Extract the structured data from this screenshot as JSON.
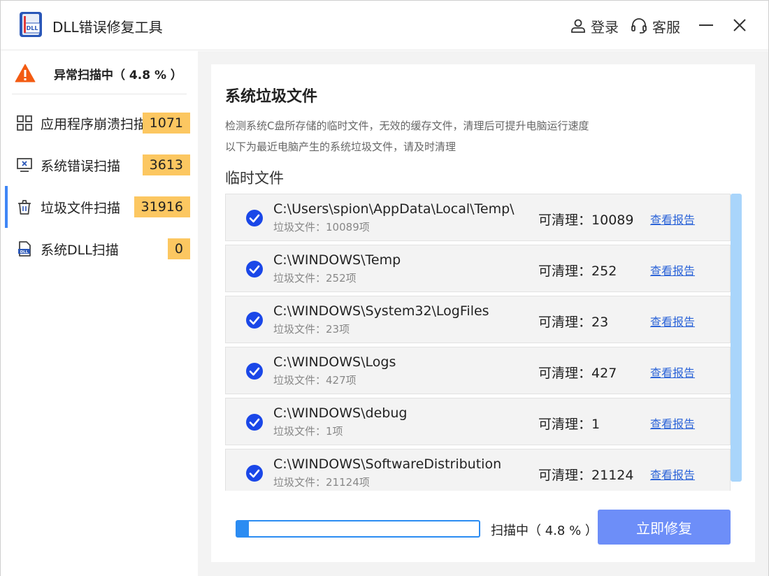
{
  "app": {
    "title": "DLL错误修复工具",
    "logo_text": "DLL"
  },
  "titlebar": {
    "login_label": "登录",
    "service_label": "客服"
  },
  "sidebar": {
    "status_label": "异常扫描中（ 4.8 % ）",
    "items": [
      {
        "label": "应用程序崩溃扫描",
        "count": "1071",
        "icon": "grid-icon"
      },
      {
        "label": "系统错误扫描",
        "count": "3613",
        "icon": "monitor-error-icon"
      },
      {
        "label": "垃圾文件扫描",
        "count": "31916",
        "icon": "trash-icon",
        "active": true
      },
      {
        "label": "系统DLL扫描",
        "count": "0",
        "icon": "dll-file-icon"
      }
    ]
  },
  "main": {
    "title": "系统垃圾文件",
    "desc1": "检测系统C盘所存储的临时文件，无效的缓存文件，清理后可提升电脑运行速度",
    "desc2": "以下为最近电脑产生的系统垃圾文件，请及时清理",
    "section_title": "临时文件",
    "rows": [
      {
        "path": "C:\\Users\\spion\\AppData\\Local\\Temp\\",
        "sub_prefix": "垃圾文件：",
        "sub_count": "10089项",
        "clean_prefix": "可清理：",
        "clean_count": "10089",
        "report": "查看报告"
      },
      {
        "path": "C:\\WINDOWS\\Temp",
        "sub_prefix": "垃圾文件：",
        "sub_count": "252项",
        "clean_prefix": "可清理：",
        "clean_count": "252",
        "report": "查看报告"
      },
      {
        "path": "C:\\WINDOWS\\System32\\LogFiles",
        "sub_prefix": "垃圾文件：",
        "sub_count": "23项",
        "clean_prefix": "可清理：",
        "clean_count": "23",
        "report": "查看报告"
      },
      {
        "path": "C:\\WINDOWS\\Logs",
        "sub_prefix": "垃圾文件：",
        "sub_count": "427项",
        "clean_prefix": "可清理：",
        "clean_count": "427",
        "report": "查看报告"
      },
      {
        "path": "C:\\WINDOWS\\debug",
        "sub_prefix": "垃圾文件：",
        "sub_count": "1项",
        "clean_prefix": "可清理：",
        "clean_count": "1",
        "report": "查看报告"
      },
      {
        "path": "C:\\WINDOWS\\SoftwareDistribution",
        "sub_prefix": "垃圾文件：",
        "sub_count": "21124项",
        "clean_prefix": "可清理：",
        "clean_count": "21124",
        "report": "查看报告"
      }
    ],
    "progress_fraction": 0.048,
    "progress_label": "扫描中（ 4.8 % ）",
    "fix_button": "立即修复"
  },
  "colors": {
    "accent": "#3f86f6",
    "badge": "#fcc761",
    "check": "#1a47e8",
    "link": "#2c64d8",
    "fix_button": "#6d8ef8",
    "warning": "#f35b12"
  }
}
